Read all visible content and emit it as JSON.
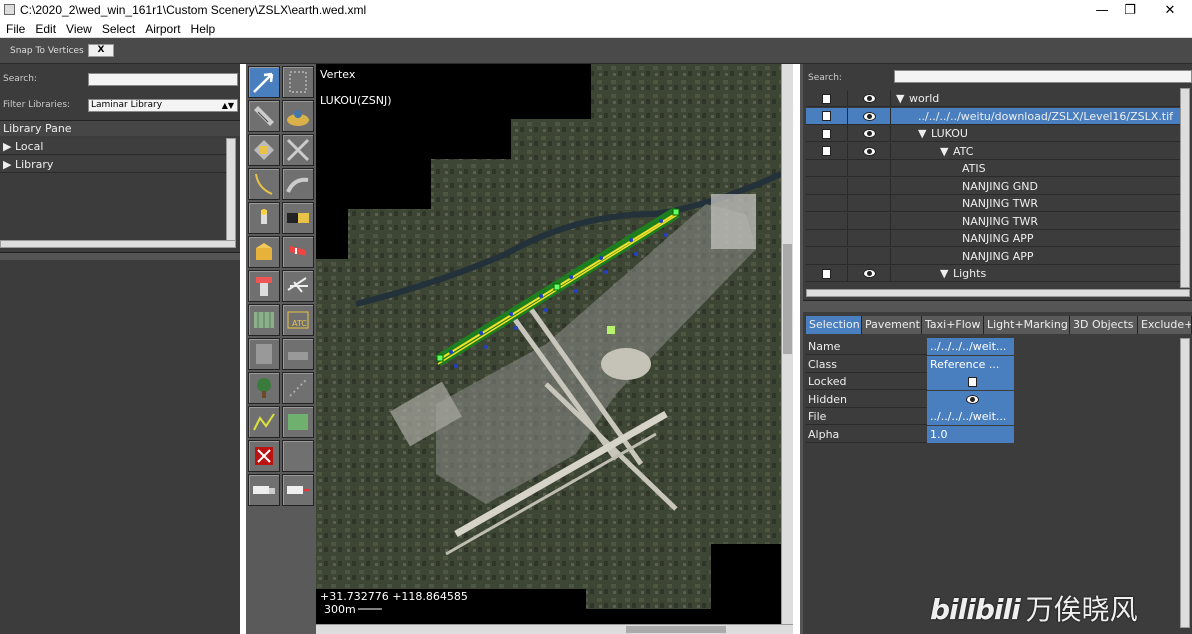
{
  "window": {
    "title": "C:\\2020_2\\wed_win_161r1\\Custom Scenery\\ZSLX\\earth.wed.xml"
  },
  "menu": [
    "File",
    "Edit",
    "View",
    "Select",
    "Airport",
    "Help"
  ],
  "toolbar": {
    "snap_label": "Snap To Vertices",
    "snap_value": "X"
  },
  "library": {
    "search_label": "Search:",
    "filter_label": "Filter Libraries:",
    "filter_value": "Laminar Library",
    "pane_title": "Library Pane",
    "items": [
      "Local",
      "Library"
    ]
  },
  "map": {
    "tool_name": "Vertex",
    "airport": "LUKOU(ZSNJ)",
    "coords": "+31.732776 +118.864585",
    "scale": "300m"
  },
  "hierarchy": {
    "search_label": "Search:",
    "rows": [
      {
        "label": "world",
        "arrow": "▼",
        "level": 0,
        "icons": true,
        "selected": false
      },
      {
        "label": "../../../../weitu/download/ZSLX/Level16/ZSLX.tif",
        "arrow": "",
        "level": 1,
        "icons": true,
        "selected": true
      },
      {
        "label": "LUKOU",
        "arrow": "▼",
        "level": 1,
        "icons": true,
        "selected": false
      },
      {
        "label": "ATC",
        "arrow": "▼",
        "level": 2,
        "icons": true,
        "selected": false
      },
      {
        "label": "ATIS",
        "arrow": "",
        "level": 3,
        "icons": false,
        "selected": false
      },
      {
        "label": "NANJING GND",
        "arrow": "",
        "level": 3,
        "icons": false,
        "selected": false
      },
      {
        "label": "NANJING TWR",
        "arrow": "",
        "level": 3,
        "icons": false,
        "selected": false
      },
      {
        "label": "NANJING TWR",
        "arrow": "",
        "level": 3,
        "icons": false,
        "selected": false
      },
      {
        "label": "NANJING APP",
        "arrow": "",
        "level": 3,
        "icons": false,
        "selected": false
      },
      {
        "label": "NANJING APP",
        "arrow": "",
        "level": 3,
        "icons": false,
        "selected": false
      },
      {
        "label": "Lights",
        "arrow": "▼",
        "level": 2,
        "icons": true,
        "selected": false
      }
    ]
  },
  "tabs": [
    "Selection",
    "Pavement",
    "Taxi+Flow",
    "Light+Marking",
    "3D Objects",
    "Exclude+I"
  ],
  "properties": [
    {
      "key": "Name",
      "value": "../../../../weit..."
    },
    {
      "key": "Class",
      "value": "Reference ..."
    },
    {
      "key": "Locked",
      "value": "",
      "icon": "lock-icon"
    },
    {
      "key": "Hidden",
      "value": "",
      "icon": "eye-icon"
    },
    {
      "key": "File",
      "value": "../../../../weit..."
    },
    {
      "key": "Alpha",
      "value": "1.0"
    }
  ],
  "watermark": "万俟晓风"
}
